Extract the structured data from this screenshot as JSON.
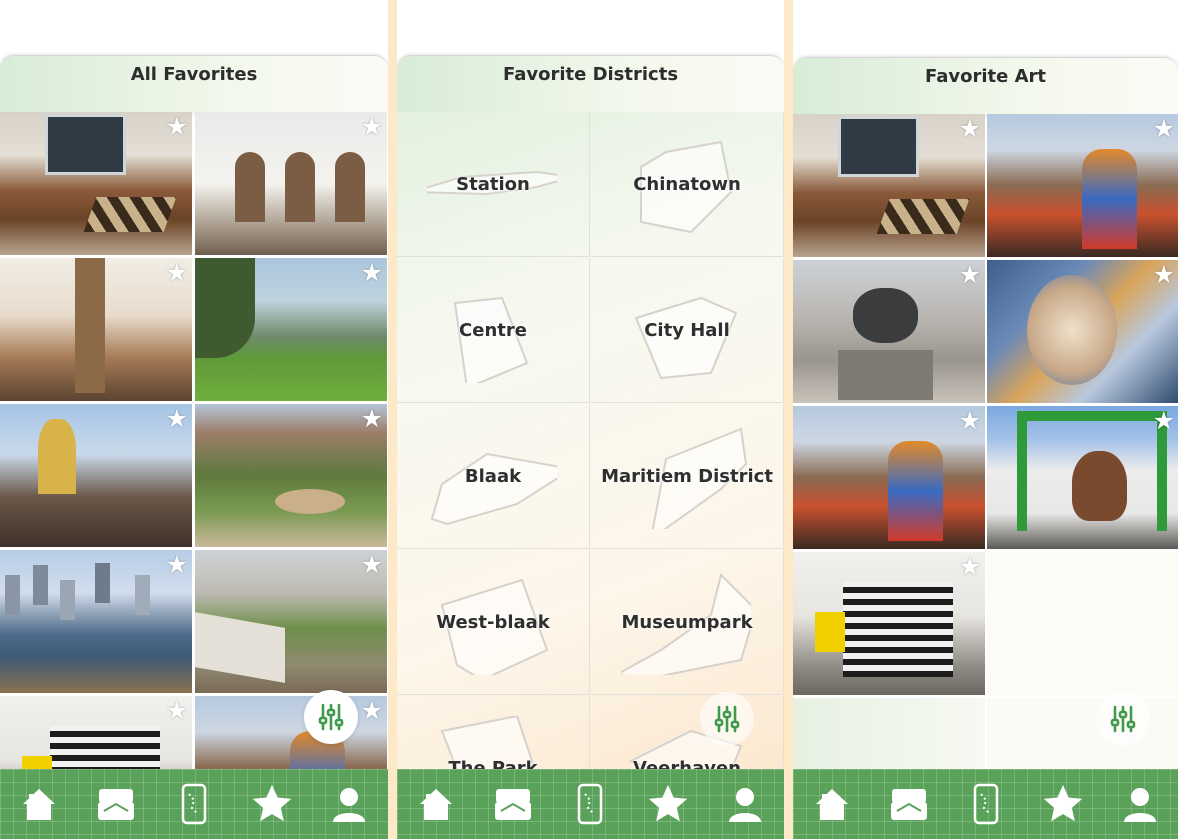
{
  "screens": [
    {
      "title": "All Favorites",
      "tiles": [
        {
          "photo": "chess-cafe",
          "favorite": true
        },
        {
          "photo": "arched-facade",
          "favorite": true
        },
        {
          "photo": "cat-cafe-interior",
          "favorite": true
        },
        {
          "photo": "park-lawn",
          "favorite": true
        },
        {
          "photo": "terrace-umbrellas",
          "favorite": true
        },
        {
          "photo": "ivy-courtyard-fountain",
          "favorite": true
        },
        {
          "photo": "river-skyline",
          "favorite": true
        },
        {
          "photo": "courtyard-market",
          "favorite": true
        },
        {
          "photo": "striped-house-art",
          "favorite": true
        },
        {
          "photo": "skyline-mural",
          "favorite": true
        }
      ]
    },
    {
      "title": "Favorite Districts",
      "districts": [
        {
          "label": "Station"
        },
        {
          "label": "Chinatown"
        },
        {
          "label": "Centre"
        },
        {
          "label": "City Hall"
        },
        {
          "label": "Blaak"
        },
        {
          "label": "Maritiem District"
        },
        {
          "label": "West-blaak"
        },
        {
          "label": "Museumpark"
        },
        {
          "label": "The Park"
        },
        {
          "label": "Veerhaven"
        }
      ]
    },
    {
      "title": "Favorite Art",
      "tiles": [
        {
          "photo": "chess-cafe",
          "favorite": true
        },
        {
          "photo": "skyline-mural",
          "favorite": true
        },
        {
          "photo": "monkey-statue",
          "favorite": true
        },
        {
          "photo": "face-mural",
          "favorite": true
        },
        {
          "photo": "street-mural",
          "favorite": true
        },
        {
          "photo": "green-wall-mural",
          "favorite": true
        },
        {
          "photo": "striped-house-art",
          "favorite": true
        }
      ]
    }
  ],
  "icons": {
    "star": "star-icon",
    "filter": "filter-sliders-icon",
    "nav": [
      "home-icon",
      "tickets-icon",
      "phone-map-icon",
      "star-icon",
      "profile-icon"
    ]
  },
  "colors": {
    "nav_green": "#5aa25a",
    "accent_green": "#3f9a4a",
    "star_white": "#ffffff"
  }
}
